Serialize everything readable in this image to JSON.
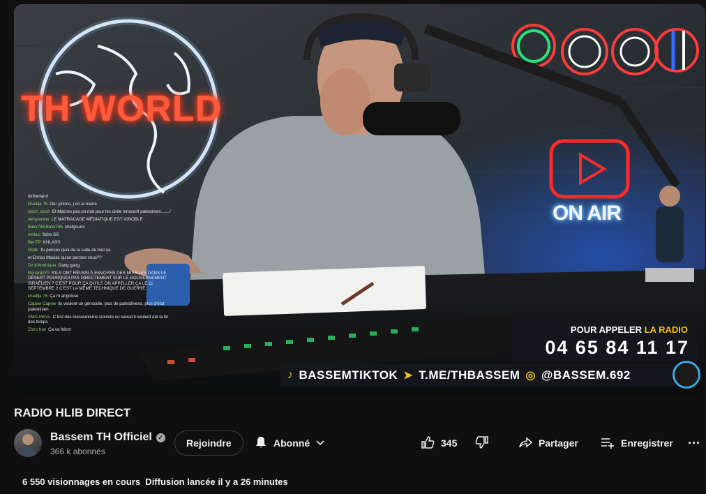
{
  "player": {
    "neon_sign": "TH WORLD",
    "neon_on_air": "ON AIR",
    "phone_label_prefix": "POUR APPELER",
    "phone_label_accent": "LA RADIO",
    "phone_number": "04 65 84 11 17",
    "socials": [
      {
        "icon": "tiktok-icon",
        "text": "BASSEMTIKTOK"
      },
      {
        "icon": "telegram-icon",
        "text": "T.ME/THBASSEM"
      },
      {
        "icon": "instagram-icon",
        "text": "@BASSEM.692"
      }
    ],
    "chat": [
      {
        "user": "",
        "text": "timberland"
      },
      {
        "user": "khadija 76",
        "text": "Oui ,prions, j en ai marre"
      },
      {
        "user": "skich_skich",
        "text": "Et Macron pas un mot pour les civile innocent palestinien......./"
      },
      {
        "user": "Akhylander",
        "text": "LE MATRACAGE MÉDIATIQUE EST IGNOBLE"
      },
      {
        "user": "Bakk786 Bakk786",
        "text": "chelgoumi"
      },
      {
        "user": "rimkus",
        "text": "fiche SS"
      },
      {
        "user": "BenTP",
        "text": "KHLASS"
      },
      {
        "user": "Malik",
        "text": "Tu penses quoi de la suite de tout ça"
      },
      {
        "user": "",
        "text": "et Enrico Macias qu'en penses vous??"
      },
      {
        "user": "Dz d'Amérique",
        "text": "Gang gang"
      },
      {
        "user": "Renard270",
        "text": "S'ILS ONT RÉUSSI À ENVOYER DES MISSILES DANS LE DÉSERT POURQUOI PAS DIRECTEMENT SUR LE GOUVERNEMENT ISRAÉLIEN ? C'EST POUR ÇA QU'ILS ON APPELLER ÇA LE 11 SEPTEMBRE 2 C'EST LA MÊME TECHNIQUE DE GUERRE"
      },
      {
        "user": "khadija 76",
        "text": "Ça m angoisse"
      },
      {
        "user": "Capew Capew",
        "text": "ils veulent un génocide, plus de palestiniens, plus d'état palestinien"
      },
      {
        "user": "AMG MKVL",
        "text": "C Est des messianisme sioniste ou saoud il veulent até la fin des temps"
      },
      {
        "user": "Zozo Kov",
        "text": "Ça va frérot"
      }
    ]
  },
  "video": {
    "title": "RADIO HLIB DIRECT",
    "stats": "6 550 visionnages en cours  Diffusion lancée il y a 26 minutes"
  },
  "channel": {
    "name": "Bassem TH Officiel",
    "subscribers": "366 k abonnés",
    "verified_icon": "verified-check-icon"
  },
  "actions": {
    "join_label": "Rejoindre",
    "subscribed_label": "Abonné",
    "like_count": "345",
    "share_label": "Partager",
    "save_label": "Enregistrer"
  },
  "colors": {
    "background": "#0f0f0f",
    "banner_accent": "#f3c10f",
    "neon_red": "#ff5a3c",
    "chat_username": "#8fd46a"
  }
}
